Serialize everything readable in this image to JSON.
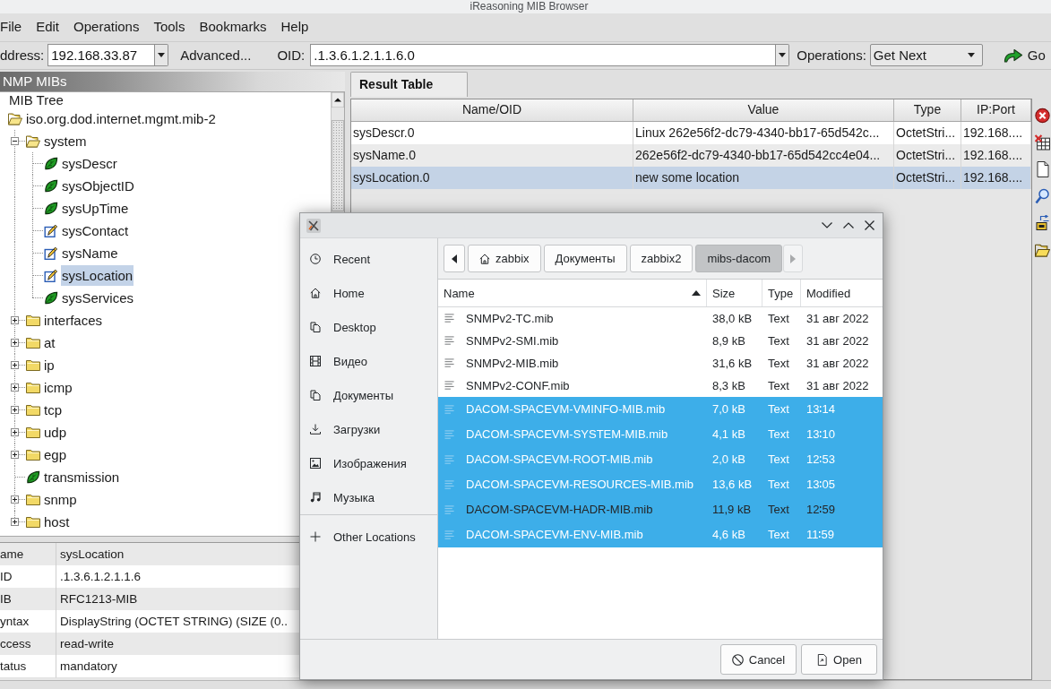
{
  "window": {
    "title": "iReasoning MIB Browser"
  },
  "menu": [
    "File",
    "Edit",
    "Operations",
    "Tools",
    "Bookmarks",
    "Help"
  ],
  "toolbar": {
    "address_label": "ddress:",
    "address": "192.168.33.87",
    "advanced": "Advanced...",
    "oid_label": "OID:",
    "oid": ".1.3.6.1.2.1.1.6.0",
    "operations_label": "Operations:",
    "operation": "Get Next",
    "go": "Go"
  },
  "mib_panel": {
    "title": "NMP MIBs",
    "tree": [
      {
        "label": "MIB Tree",
        "selected": false,
        "children": [
          {
            "label": "iso.org.dod.internet.mgmt.mib-2",
            "kind": "folder",
            "selected": false,
            "children": [
              {
                "label": "system",
                "kind": "folder",
                "expanded": true,
                "selected": false,
                "children": [
                  {
                    "label": "sysDescr",
                    "kind": "leaf",
                    "selected": false
                  },
                  {
                    "label": "sysObjectID",
                    "kind": "leaf",
                    "selected": false
                  },
                  {
                    "label": "sysUpTime",
                    "kind": "leaf",
                    "selected": false
                  },
                  {
                    "label": "sysContact",
                    "kind": "writable",
                    "selected": false
                  },
                  {
                    "label": "sysName",
                    "kind": "writable",
                    "selected": false
                  },
                  {
                    "label": "sysLocation",
                    "kind": "writable",
                    "selected": true
                  },
                  {
                    "label": "sysServices",
                    "kind": "leaf",
                    "selected": false
                  }
                ]
              },
              {
                "label": "interfaces",
                "kind": "folder",
                "expanded": false,
                "selected": false
              },
              {
                "label": "at",
                "kind": "folder",
                "expanded": false,
                "selected": false
              },
              {
                "label": "ip",
                "kind": "folder",
                "expanded": false,
                "selected": false
              },
              {
                "label": "icmp",
                "kind": "folder",
                "expanded": false,
                "selected": false
              },
              {
                "label": "tcp",
                "kind": "folder",
                "expanded": false,
                "selected": false
              },
              {
                "label": "udp",
                "kind": "folder",
                "expanded": false,
                "selected": false
              },
              {
                "label": "egp",
                "kind": "folder",
                "expanded": false,
                "selected": false
              },
              {
                "label": "transmission",
                "kind": "leaf",
                "selected": false
              },
              {
                "label": "snmp",
                "kind": "folder",
                "expanded": false,
                "selected": false
              },
              {
                "label": "host",
                "kind": "folder",
                "expanded": false,
                "selected": false
              }
            ]
          }
        ]
      }
    ]
  },
  "properties": [
    {
      "name": "ame",
      "value": "sysLocation"
    },
    {
      "name": "ID",
      "value": ".1.3.6.1.2.1.1.6"
    },
    {
      "name": "IB",
      "value": "RFC1213-MIB"
    },
    {
      "name": "yntax",
      "value": "DisplayString (OCTET STRING) (SIZE (0.."
    },
    {
      "name": "ccess",
      "value": "read-write"
    },
    {
      "name": "tatus",
      "value": "mandatory"
    }
  ],
  "result_tabs": [
    {
      "label": "Result Table",
      "selected": true
    }
  ],
  "result_table": {
    "columns": [
      "Name/OID",
      "Value",
      "Type",
      "IP:Port"
    ],
    "rows": [
      {
        "cells": [
          "sysDescr.0",
          "Linux 262e56f2-dc79-4340-bb17-65d542c...",
          "OctetStri...",
          "192.168...."
        ],
        "selected": false
      },
      {
        "cells": [
          "sysName.0",
          "262e56f2-dc79-4340-bb17-65d542cc4e04...",
          "OctetStri...",
          "192.168...."
        ],
        "selected": false
      },
      {
        "cells": [
          "sysLocation.0",
          "new some location",
          "OctetStri...",
          "192.168...."
        ],
        "selected": true
      }
    ]
  },
  "file_dialog": {
    "places": [
      {
        "label": "Recent",
        "kind": "recent"
      },
      {
        "label": "Home",
        "kind": "home"
      },
      {
        "label": "Desktop",
        "kind": "documents"
      },
      {
        "label": "Видео",
        "kind": "video"
      },
      {
        "label": "Документы",
        "kind": "documents"
      },
      {
        "label": "Загрузки",
        "kind": "download"
      },
      {
        "label": "Изображения",
        "kind": "image"
      },
      {
        "label": "Музыка",
        "kind": "music"
      }
    ],
    "other_locations": "Other Locations",
    "back_disabled": false,
    "forward_disabled": true,
    "path": [
      {
        "label": "zabbix",
        "kind": "home",
        "selected": false
      },
      {
        "label": "Документы",
        "kind": "folder",
        "selected": false
      },
      {
        "label": "zabbix2",
        "kind": "folder",
        "selected": false
      },
      {
        "label": "mibs-dacom",
        "kind": "folder",
        "selected": true
      }
    ],
    "columns": [
      {
        "label": "Name",
        "sorted": true
      },
      {
        "label": "Size",
        "sorted": false
      },
      {
        "label": "Type",
        "sorted": false
      },
      {
        "label": "Modified",
        "sorted": false
      }
    ],
    "files": [
      {
        "name": "SNMPv2-TC.mib",
        "size": "38,0 kB",
        "type": "Text",
        "modified": "31 авг 2022",
        "selected": false,
        "focused": false
      },
      {
        "name": "SNMPv2-SMI.mib",
        "size": "8,9 kB",
        "type": "Text",
        "modified": "31 авг 2022",
        "selected": false,
        "focused": false
      },
      {
        "name": "SNMPv2-MIB.mib",
        "size": "31,6 kB",
        "type": "Text",
        "modified": "31 авг 2022",
        "selected": false,
        "focused": false
      },
      {
        "name": "SNMPv2-CONF.mib",
        "size": "8,3 kB",
        "type": "Text",
        "modified": "31 авг 2022",
        "selected": false,
        "focused": false
      },
      {
        "name": "DACOM-SPACEVM-VMINFO-MIB.mib",
        "size": "7,0 kB",
        "type": "Text",
        "modified": "13∶14",
        "selected": true,
        "focused": false
      },
      {
        "name": "DACOM-SPACEVM-SYSTEM-MIB.mib",
        "size": "4,1 kB",
        "type": "Text",
        "modified": "13∶10",
        "selected": true,
        "focused": false
      },
      {
        "name": "DACOM-SPACEVM-ROOT-MIB.mib",
        "size": "2,0 kB",
        "type": "Text",
        "modified": "12∶53",
        "selected": true,
        "focused": false
      },
      {
        "name": "DACOM-SPACEVM-RESOURCES-MIB.mib",
        "size": "13,6 kB",
        "type": "Text",
        "modified": "13∶05",
        "selected": true,
        "focused": false
      },
      {
        "name": "DACOM-SPACEVM-HADR-MIB.mib",
        "size": "11,9 kB",
        "type": "Text",
        "modified": "12∶59",
        "selected": true,
        "focused": true
      },
      {
        "name": "DACOM-SPACEVM-ENV-MIB.mib",
        "size": "4,6 kB",
        "type": "Text",
        "modified": "11∶59",
        "selected": true,
        "focused": false
      }
    ],
    "buttons": [
      {
        "label": "Cancel",
        "kind": "cancel"
      },
      {
        "label": "Open",
        "kind": "open"
      }
    ]
  }
}
